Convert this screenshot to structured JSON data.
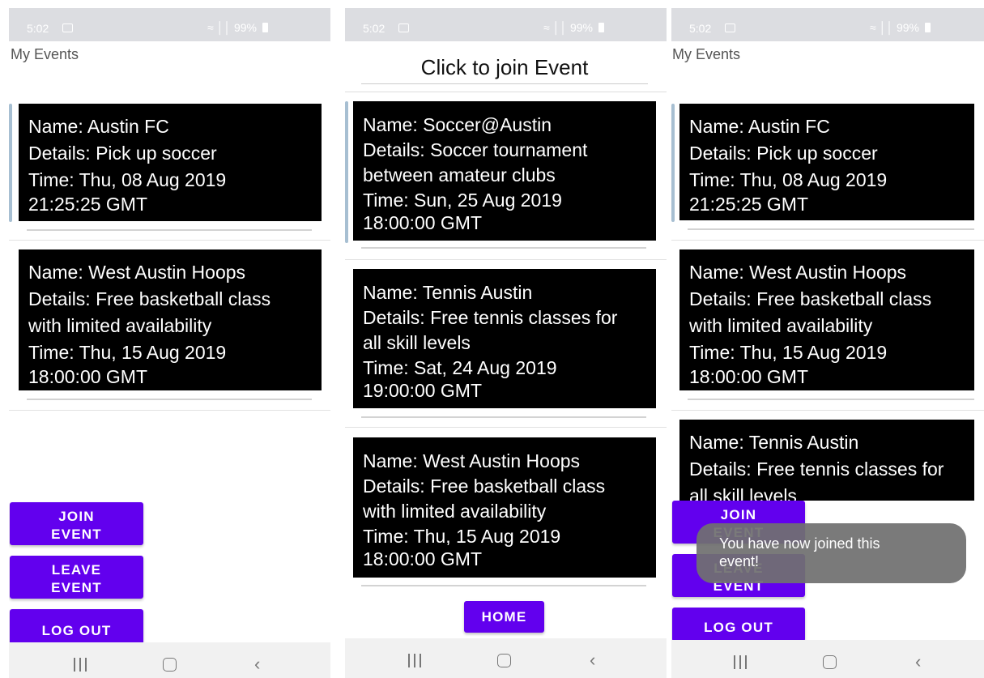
{
  "status_bar": {
    "time": "5:02",
    "indicators": "99%"
  },
  "screens": {
    "my_events": {
      "title": "My Events"
    },
    "join": {
      "title": "Click to join Event"
    }
  },
  "events": {
    "austin_fc": {
      "name": "Name: Austin FC",
      "details": "Details: Pick up soccer",
      "time_1": "Time: Thu, 08 Aug 2019",
      "time_2": "21:25:25 GMT"
    },
    "west_austin_hoops": {
      "name": "Name: West Austin Hoops",
      "details_1": "Details: Free basketball class",
      "details_2": "with limited availability",
      "time_1": "Time: Thu, 15 Aug 2019",
      "time_2": "18:00:00 GMT"
    },
    "soccer_austin": {
      "name": "Name: Soccer@Austin",
      "details_1": "Details: Soccer tournament",
      "details_2": "between amateur clubs",
      "time_1": "Time: Sun, 25 Aug 2019",
      "time_2": "18:00:00 GMT"
    },
    "tennis_austin": {
      "name": "Name: Tennis Austin",
      "details_1": "Details: Free tennis classes for",
      "details_2": "all skill levels",
      "time_1": "Time: Sat, 24 Aug 2019",
      "time_2": "19:00:00 GMT"
    }
  },
  "buttons": {
    "join_1": "JOIN",
    "join_2": "EVENT",
    "leave_1": "LEAVE",
    "leave_2": "EVENT",
    "logout": "LOG OUT",
    "home": "HOME"
  },
  "toast": {
    "line_1": "You have now joined this",
    "line_2": "event!"
  },
  "icons": {
    "status_image": "image-icon",
    "nav_recent": "recent-apps-icon",
    "nav_home": "home-icon",
    "nav_back": "back-icon",
    "battery": "battery-icon",
    "wifi": "wifi-icon",
    "signal": "signal-icon"
  },
  "colors": {
    "accent": "#6200ee",
    "card_background": "#000000",
    "status_bar": "#dcdde1",
    "toast": "#707070",
    "nav_bar": "#f1f1f1"
  }
}
